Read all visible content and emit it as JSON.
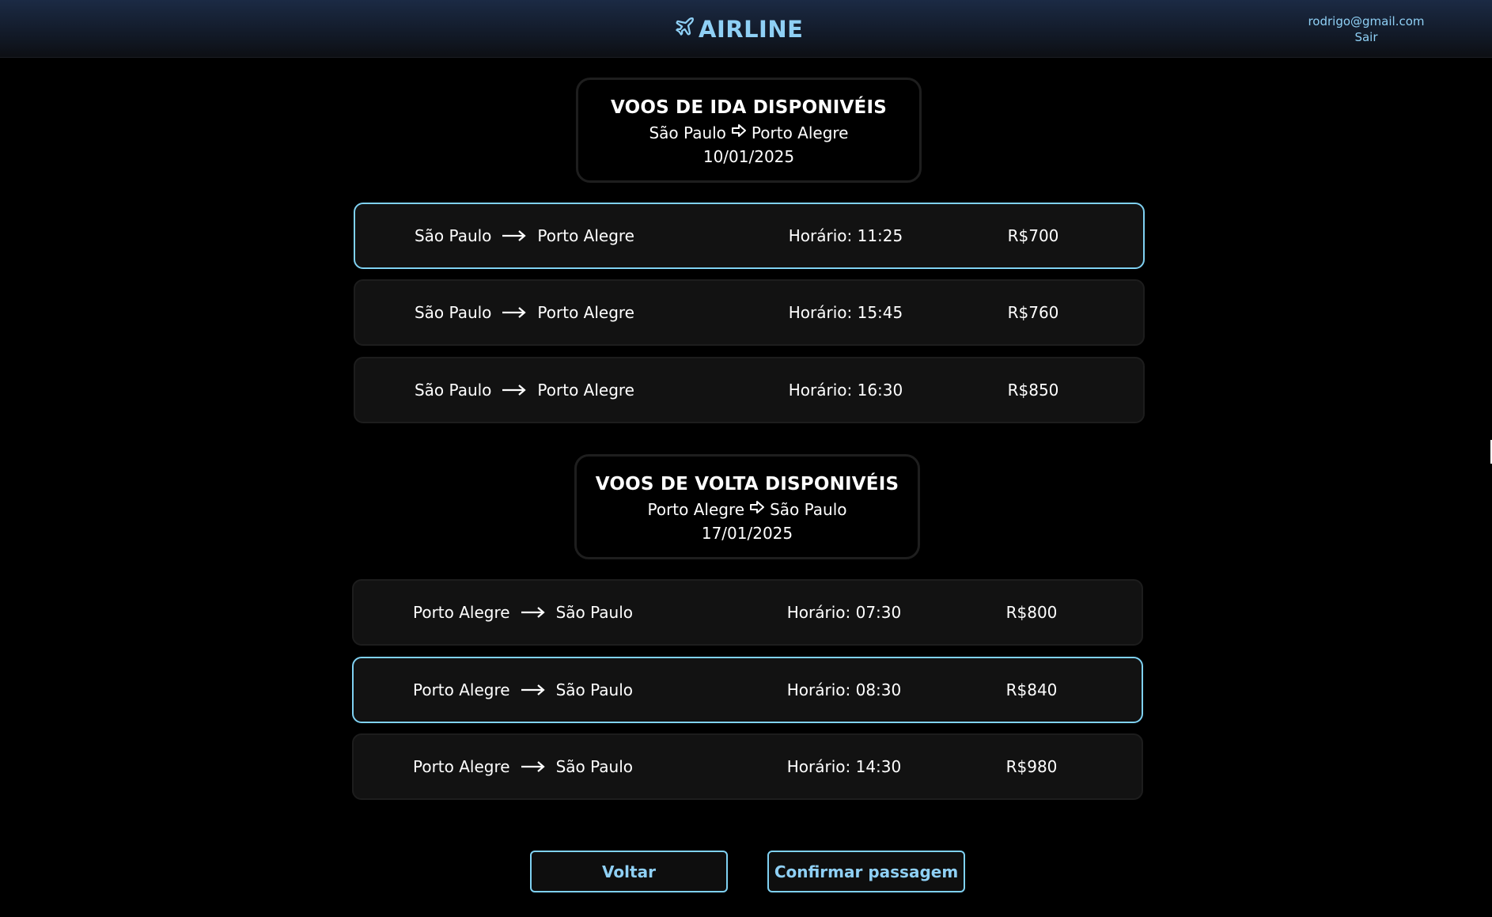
{
  "header": {
    "logo_text": "AIRLINE",
    "logo_icon": "plane-icon",
    "user_email": "rodrigo@gmail.com",
    "logout_label": "Sair"
  },
  "outbound": {
    "title": "VOOS DE IDA DISPONIVÉIS",
    "origin": "São Paulo",
    "destination": "Porto Alegre",
    "date": "10/01/2025",
    "flights": [
      {
        "origin": "São Paulo",
        "destination": "Porto Alegre",
        "time": "Horário: 11:25",
        "price": "R$700",
        "selected": true
      },
      {
        "origin": "São Paulo",
        "destination": "Porto Alegre",
        "time": "Horário: 15:45",
        "price": "R$760",
        "selected": false
      },
      {
        "origin": "São Paulo",
        "destination": "Porto Alegre",
        "time": "Horário: 16:30",
        "price": "R$850",
        "selected": false
      }
    ]
  },
  "return": {
    "title": "VOOS DE VOLTA DISPONIVÉIS",
    "origin": "Porto Alegre",
    "destination": "São Paulo",
    "date": "17/01/2025",
    "flights": [
      {
        "origin": "Porto Alegre",
        "destination": "São Paulo",
        "time": "Horário: 07:30",
        "price": "R$800",
        "selected": false
      },
      {
        "origin": "Porto Alegre",
        "destination": "São Paulo",
        "time": "Horário: 08:30",
        "price": "R$840",
        "selected": true
      },
      {
        "origin": "Porto Alegre",
        "destination": "São Paulo",
        "time": "Horário: 14:30",
        "price": "R$980",
        "selected": false
      }
    ]
  },
  "actions": {
    "back_label": "Voltar",
    "confirm_label": "Confirmar passagem"
  },
  "colors": {
    "accent": "#7fd1f2",
    "background": "#000000",
    "card": "#121212"
  }
}
